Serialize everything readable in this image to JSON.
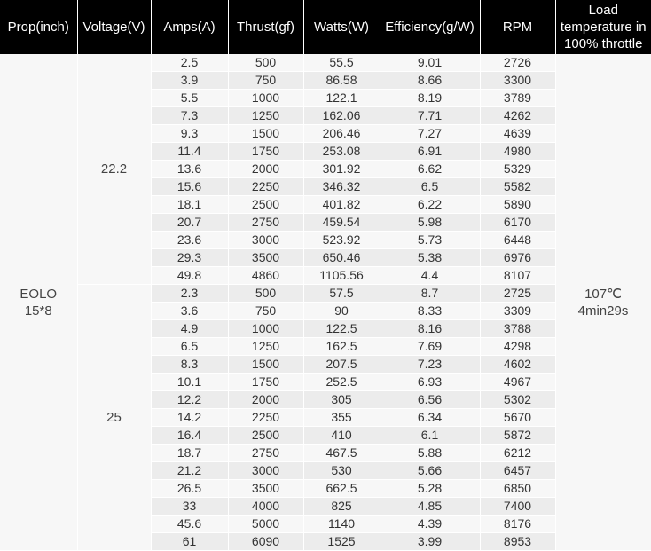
{
  "headers": [
    "Prop(inch)",
    "Voltage(V)",
    "Amps(A)",
    "Thrust(gf)",
    "Watts(W)",
    "Efficiency(g/W)",
    "RPM",
    "Load temperature in 100% throttle"
  ],
  "prop": {
    "line1": "EOLO",
    "line2": "15*8"
  },
  "temperature": {
    "line1": "107℃",
    "line2": "4min29s"
  },
  "groups": [
    {
      "voltage": "22.2",
      "rows": [
        [
          "2.5",
          "500",
          "55.5",
          "9.01",
          "2726"
        ],
        [
          "3.9",
          "750",
          "86.58",
          "8.66",
          "3300"
        ],
        [
          "5.5",
          "1000",
          "122.1",
          "8.19",
          "3789"
        ],
        [
          "7.3",
          "1250",
          "162.06",
          "7.71",
          "4262"
        ],
        [
          "9.3",
          "1500",
          "206.46",
          "7.27",
          "4639"
        ],
        [
          "11.4",
          "1750",
          "253.08",
          "6.91",
          "4980"
        ],
        [
          "13.6",
          "2000",
          "301.92",
          "6.62",
          "5329"
        ],
        [
          "15.6",
          "2250",
          "346.32",
          "6.5",
          "5582"
        ],
        [
          "18.1",
          "2500",
          "401.82",
          "6.22",
          "5890"
        ],
        [
          "20.7",
          "2750",
          "459.54",
          "5.98",
          "6170"
        ],
        [
          "23.6",
          "3000",
          "523.92",
          "5.73",
          "6448"
        ],
        [
          "29.3",
          "3500",
          "650.46",
          "5.38",
          "6976"
        ],
        [
          "49.8",
          "4860",
          "1105.56",
          "4.4",
          "8107"
        ]
      ]
    },
    {
      "voltage": "25",
      "rows": [
        [
          "2.3",
          "500",
          "57.5",
          "8.7",
          "2725"
        ],
        [
          "3.6",
          "750",
          "90",
          "8.33",
          "3309"
        ],
        [
          "4.9",
          "1000",
          "122.5",
          "8.16",
          "3788"
        ],
        [
          "6.5",
          "1250",
          "162.5",
          "7.69",
          "4298"
        ],
        [
          "8.3",
          "1500",
          "207.5",
          "7.23",
          "4602"
        ],
        [
          "10.1",
          "1750",
          "252.5",
          "6.93",
          "4967"
        ],
        [
          "12.2",
          "2000",
          "305",
          "6.56",
          "5302"
        ],
        [
          "14.2",
          "2250",
          "355",
          "6.34",
          "5670"
        ],
        [
          "16.4",
          "2500",
          "410",
          "6.1",
          "5872"
        ],
        [
          "18.7",
          "2750",
          "467.5",
          "5.88",
          "6212"
        ],
        [
          "21.2",
          "3000",
          "530",
          "5.66",
          "6457"
        ],
        [
          "26.5",
          "3500",
          "662.5",
          "5.28",
          "6850"
        ],
        [
          "33",
          "4000",
          "825",
          "4.85",
          "7400"
        ],
        [
          "45.6",
          "5000",
          "1140",
          "4.39",
          "8176"
        ],
        [
          "61",
          "6090",
          "1525",
          "3.99",
          "8953"
        ]
      ]
    }
  ]
}
